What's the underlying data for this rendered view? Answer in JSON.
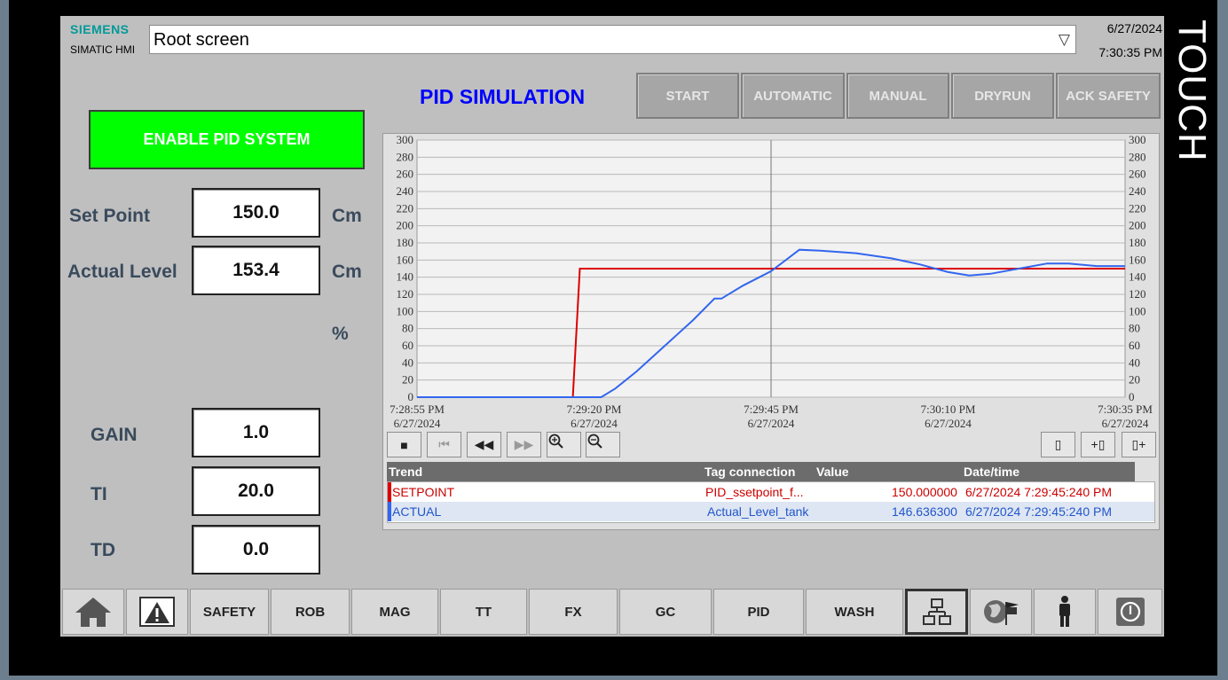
{
  "device": {
    "touch_label": "TOUCH"
  },
  "header": {
    "brand": "SIEMENS",
    "product": "SIMATIC HMI",
    "screen_selector": "Root screen",
    "date": "6/27/2024",
    "time": "7:30:35 PM"
  },
  "title": "PID SIMULATION",
  "mode_buttons": [
    "START",
    "AUTOMATIC",
    "MANUAL",
    "DRYRUN",
    "ACK SAFETY"
  ],
  "enable_button": "ENABLE PID SYSTEM",
  "parameters": {
    "setpoint": {
      "label": "Set Point",
      "value": "150.0",
      "unit": "Cm"
    },
    "actual": {
      "label": "Actual Level",
      "value": "153.4",
      "unit": "Cm"
    },
    "percent_unit": "%",
    "gain": {
      "label": "GAIN",
      "value": "1.0"
    },
    "ti": {
      "label": "TI",
      "value": "20.0"
    },
    "td": {
      "label": "TD",
      "value": "0.0"
    }
  },
  "trend_controls": [
    "stop",
    "first",
    "rewind",
    "forward",
    "zoom-in",
    "zoom-out",
    "ruler",
    "ruler-back",
    "ruler-forward"
  ],
  "trend_table": {
    "headers": [
      "Trend",
      "Tag connection",
      "Value",
      "Date/time"
    ],
    "rows": [
      {
        "trend": "SETPOINT",
        "tag": "PID_ssetpoint_f...",
        "value": "150.000000",
        "datetime": "6/27/2024 7:29:45:240 PM",
        "color": "#cc0000"
      },
      {
        "trend": "ACTUAL",
        "tag": "Actual_Level_tank",
        "value": "146.636300",
        "datetime": "6/27/2024 7:29:45:240 PM",
        "color": "#2255cc"
      }
    ]
  },
  "nav": {
    "items": [
      "home",
      "alarm",
      "SAFETY",
      "ROB",
      "MAG",
      "TT",
      "FX",
      "GC",
      "PID",
      "WASH",
      "network",
      "language",
      "user",
      "power"
    ]
  },
  "chart_data": {
    "type": "line",
    "x_ticks": [
      {
        "time": "7:28:55 PM",
        "date": "6/27/2024"
      },
      {
        "time": "7:29:20 PM",
        "date": "6/27/2024"
      },
      {
        "time": "7:29:45 PM",
        "date": "6/27/2024"
      },
      {
        "time": "7:30:10 PM",
        "date": "6/27/2024"
      },
      {
        "time": "7:30:35 PM",
        "date": "6/27/2024"
      }
    ],
    "xlim": [
      "7:28:55 PM",
      "7:30:35 PM"
    ],
    "ylim": [
      0,
      300
    ],
    "y_ticks": [
      0,
      20,
      40,
      60,
      80,
      100,
      120,
      140,
      160,
      180,
      200,
      220,
      240,
      260,
      280,
      300
    ],
    "grid": true,
    "series": [
      {
        "name": "SETPOINT",
        "color": "#dd0000",
        "points": [
          [
            "7:28:55 PM",
            0
          ],
          [
            "7:29:17 PM",
            0
          ],
          [
            "7:29:18 PM",
            150
          ],
          [
            "7:30:35 PM",
            150
          ]
        ]
      },
      {
        "name": "ACTUAL",
        "color": "#3366ee",
        "points": [
          [
            "7:28:55 PM",
            0
          ],
          [
            "7:29:21 PM",
            0
          ],
          [
            "7:29:23 PM",
            10
          ],
          [
            "7:29:26 PM",
            30
          ],
          [
            "7:29:30 PM",
            60
          ],
          [
            "7:29:34 PM",
            90
          ],
          [
            "7:29:37 PM",
            115
          ],
          [
            "7:29:38 PM",
            115
          ],
          [
            "7:29:41 PM",
            130
          ],
          [
            "7:29:45 PM",
            147
          ],
          [
            "7:29:49 PM",
            172
          ],
          [
            "7:29:52 PM",
            171
          ],
          [
            "7:29:57 PM",
            168
          ],
          [
            "7:30:02 PM",
            162
          ],
          [
            "7:30:06 PM",
            155
          ],
          [
            "7:30:10 PM",
            146
          ],
          [
            "7:30:13 PM",
            142
          ],
          [
            "7:30:16 PM",
            144
          ],
          [
            "7:30:20 PM",
            150
          ],
          [
            "7:30:24 PM",
            156
          ],
          [
            "7:30:27 PM",
            156
          ],
          [
            "7:30:31 PM",
            153
          ],
          [
            "7:30:35 PM",
            153
          ]
        ]
      }
    ]
  }
}
